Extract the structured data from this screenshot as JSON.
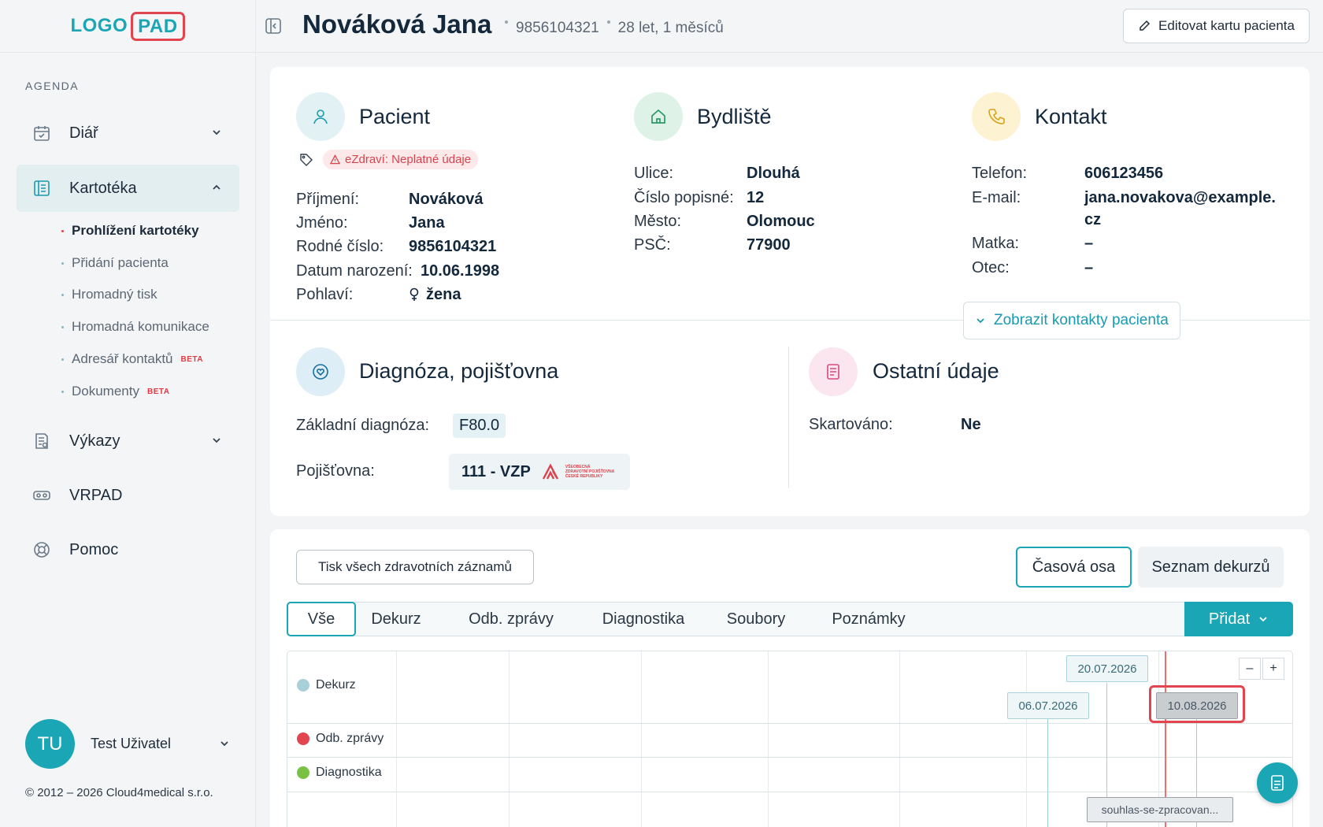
{
  "brand": {
    "logo_part1": "LOGO",
    "logo_part2": "PAD",
    "accent": "#1aa6b5",
    "logo_border": "#e2454f"
  },
  "sidebar": {
    "section_title": "AGENDA",
    "items": [
      {
        "label": "Diář",
        "icon": "calendar-icon",
        "expanded": false
      },
      {
        "label": "Kartotéka",
        "icon": "list-book-icon",
        "expanded": true
      },
      {
        "label": "Výkazy",
        "icon": "report-icon",
        "expanded": false
      },
      {
        "label": "VRPAD",
        "icon": "vr-headset-icon"
      },
      {
        "label": "Pomoc",
        "icon": "lifebuoy-icon"
      }
    ],
    "subitems": [
      {
        "label": "Prohlížení kartotéky",
        "active": true
      },
      {
        "label": "Přidání pacienta"
      },
      {
        "label": "Hromadný tisk"
      },
      {
        "label": "Hromadná komunikace"
      },
      {
        "label": "Adresář kontaktů",
        "badge": "BETA"
      },
      {
        "label": "Dokumenty",
        "badge": "BETA"
      }
    ],
    "user": {
      "initials": "TU",
      "name": "Test Uživatel"
    },
    "copyright": "© 2012 – 2026 Cloud4medical s.r.o."
  },
  "header": {
    "patient_name": "Nováková Jana",
    "birth_number": "9856104321",
    "age": "28 let, 1 měsíců",
    "edit_button": "Editovat kartu pacienta"
  },
  "patient": {
    "title": "Pacient",
    "warning": "eZdraví: Neplatné údaje",
    "fields": [
      {
        "label": "Příjmení:",
        "value": "Nováková"
      },
      {
        "label": "Jméno:",
        "value": "Jana"
      },
      {
        "label": "Rodné číslo:",
        "value": "9856104321"
      },
      {
        "label": "Datum narození:",
        "value": "10.06.1998"
      },
      {
        "label": "Pohlaví:",
        "value": "žena"
      }
    ]
  },
  "address": {
    "title": "Bydliště",
    "fields": [
      {
        "label": "Ulice:",
        "value": "Dlouhá"
      },
      {
        "label": "Číslo popisné:",
        "value": "12"
      },
      {
        "label": "Město:",
        "value": "Olomouc"
      },
      {
        "label": "PSČ:",
        "value": "77900"
      }
    ]
  },
  "contact": {
    "title": "Kontakt",
    "fields": [
      {
        "label": "Telefon:",
        "value": "606123456"
      },
      {
        "label": "E-mail:",
        "value": "jana.novakova@example.",
        "value2": "cz"
      },
      {
        "label": "Matka:",
        "value": "–"
      },
      {
        "label": "Otec:",
        "value": "–"
      }
    ],
    "show_contacts": "Zobrazit kontakty pacienta"
  },
  "diagnosis": {
    "title": "Diagnóza, pojišťovna",
    "base_label": "Základní diagnóza:",
    "base_value": "F80.0",
    "insurer_label": "Pojišťovna:",
    "insurer_value": "111 - VZP",
    "insurer_logo_text": [
      "VŠEOBECNÁ",
      "ZDRAVOTNÍ POJIŠŤOVNA",
      "ČESKÉ REPUBLIKY"
    ]
  },
  "other": {
    "title": "Ostatní údaje",
    "shredded_label": "Skartováno:",
    "shredded_value": "Ne"
  },
  "records": {
    "print_button": "Tisk všech zdravotních záznamů",
    "view_timeline": "Časová osa",
    "view_list": "Seznam dekurzů",
    "tabs": [
      "Vše",
      "Dekurz",
      "Odb. zprávy",
      "Diagnostika",
      "Soubory",
      "Poznámky"
    ],
    "add_button": "Přidat"
  },
  "timeline": {
    "rows": [
      {
        "label": "Dekurz",
        "color": "#a9cfd8"
      },
      {
        "label": "Odb. zprávy",
        "color": "#e2454f"
      },
      {
        "label": "Diagnostika",
        "color": "#7ac143"
      }
    ],
    "events": [
      {
        "date": "20.07.2026"
      },
      {
        "date": "06.07.2026"
      },
      {
        "date": "10.08.2026",
        "highlighted": true
      }
    ],
    "file": "souhlas-se-zpracovan...",
    "zoom_out": "–",
    "zoom_in": "+"
  }
}
